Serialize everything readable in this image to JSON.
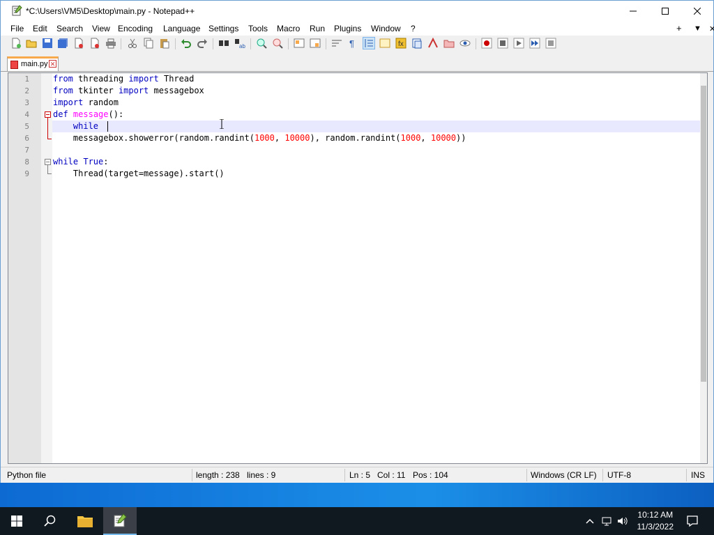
{
  "window": {
    "title": "*C:\\Users\\VM5\\Desktop\\main.py - Notepad++",
    "minimize_icon": "minimize-icon",
    "maximize_icon": "maximize-icon",
    "close_icon": "close-icon"
  },
  "menu": {
    "items": [
      "File",
      "Edit",
      "Search",
      "View",
      "Encoding",
      "Language",
      "Settings",
      "Tools",
      "Macro",
      "Run",
      "Plugins",
      "Window",
      "?"
    ],
    "right": [
      "+",
      "▼",
      "✕"
    ]
  },
  "tabs": [
    {
      "label": "main.py",
      "modified": true
    }
  ],
  "editor": {
    "line_numbers": [
      "1",
      "2",
      "3",
      "4",
      "5",
      "6",
      "7",
      "8",
      "9"
    ],
    "current_line": 5,
    "lines": [
      "from threading import Thread",
      "from tkinter import messagebox",
      "import random",
      "def message():",
      "    while ",
      "    messagebox.showerror(random.randint(1000, 10000), random.randint(1000, 10000))",
      "",
      "while True:",
      "    Thread(target=message).start()"
    ]
  },
  "status": {
    "file_type": "Python file",
    "length": "length : 238",
    "lines": "lines : 9",
    "ln": "Ln : 5",
    "col": "Col : 11",
    "pos": "Pos : 104",
    "eol": "Windows (CR LF)",
    "encoding": "UTF-8",
    "mode": "INS"
  },
  "taskbar": {
    "time": "10:12 AM",
    "date": "11/3/2022"
  },
  "colors": {
    "keyword": "#0000c0",
    "function": "#ff00ff",
    "number": "#ff0000",
    "current_line": "#e8e8ff",
    "tab_accent": "#f7a94b"
  }
}
